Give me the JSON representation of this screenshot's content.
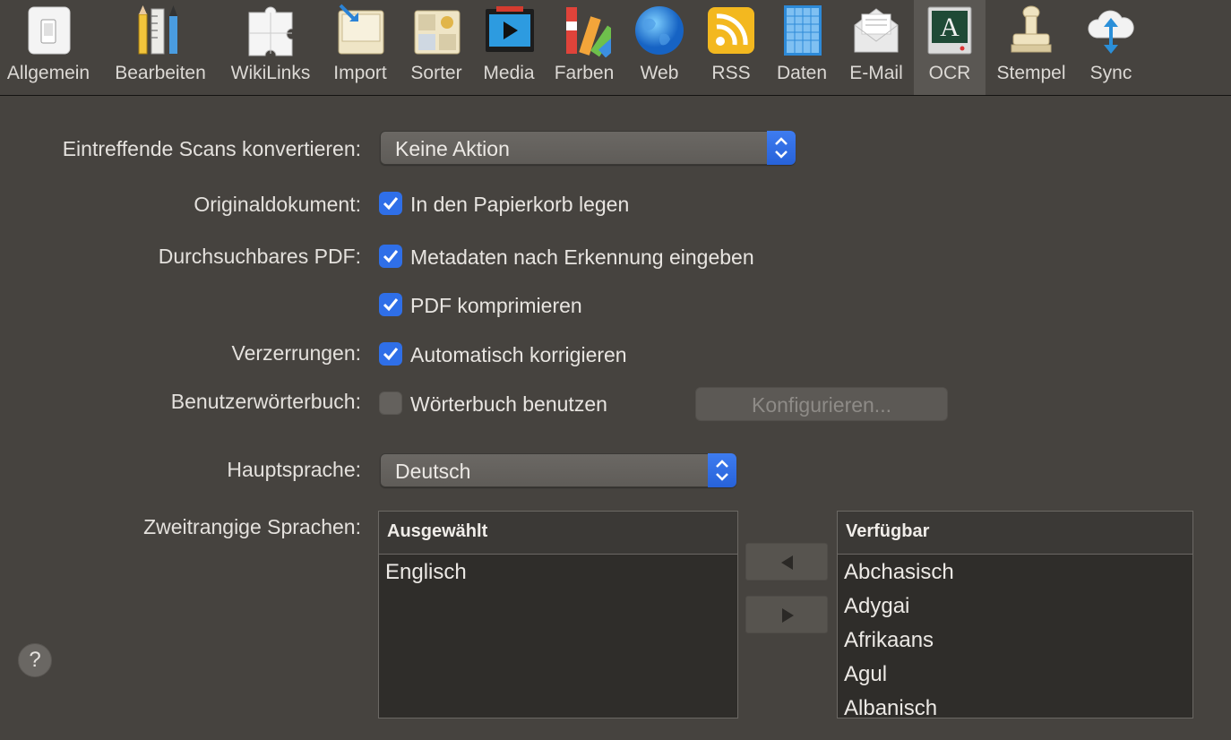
{
  "toolbar": {
    "items": [
      {
        "label": "Allgemein",
        "icon": "switch-icon"
      },
      {
        "label": "Bearbeiten",
        "icon": "pencil-ruler-icon"
      },
      {
        "label": "WikiLinks",
        "icon": "puzzle-icon"
      },
      {
        "label": "Import",
        "icon": "import-icon"
      },
      {
        "label": "Sorter",
        "icon": "sorter-icon"
      },
      {
        "label": "Media",
        "icon": "media-icon"
      },
      {
        "label": "Farben",
        "icon": "color-swatch-icon"
      },
      {
        "label": "Web",
        "icon": "globe-icon"
      },
      {
        "label": "RSS",
        "icon": "rss-icon"
      },
      {
        "label": "Daten",
        "icon": "data-grid-icon"
      },
      {
        "label": "E-Mail",
        "icon": "envelope-icon"
      },
      {
        "label": "OCR",
        "icon": "ocr-icon"
      },
      {
        "label": "Stempel",
        "icon": "stamp-icon"
      },
      {
        "label": "Sync",
        "icon": "cloud-sync-icon"
      }
    ],
    "active": "OCR"
  },
  "form": {
    "scans_label": "Eintreffende Scans konvertieren:",
    "scans_value": "Keine Aktion",
    "original_label": "Originaldokument:",
    "original_check": "In den Papierkorb legen",
    "pdf_label": "Durchsuchbares PDF:",
    "pdf_check_meta": "Metadaten nach Erkennung eingeben",
    "pdf_check_compress": "PDF komprimieren",
    "distortion_label": "Verzerrungen:",
    "distortion_check": "Automatisch korrigieren",
    "dictionary_label": "Benutzerwörterbuch:",
    "dictionary_check": "Wörterbuch benutzen",
    "configure_button": "Konfigurieren...",
    "main_language_label": "Hauptsprache:",
    "main_language_value": "Deutsch",
    "secondary_label": "Zweitrangige Sprachen:"
  },
  "selected_table": {
    "header": "Ausgewählt",
    "rows": [
      "Englisch"
    ]
  },
  "available_table": {
    "header": "Verfügbar",
    "rows": [
      "Abchasisch",
      "Adygai",
      "Afrikaans",
      "Agul",
      "Albanisch"
    ]
  },
  "help": "?",
  "colors": {
    "background": "#46433f",
    "accent": "#2f6fe8"
  }
}
